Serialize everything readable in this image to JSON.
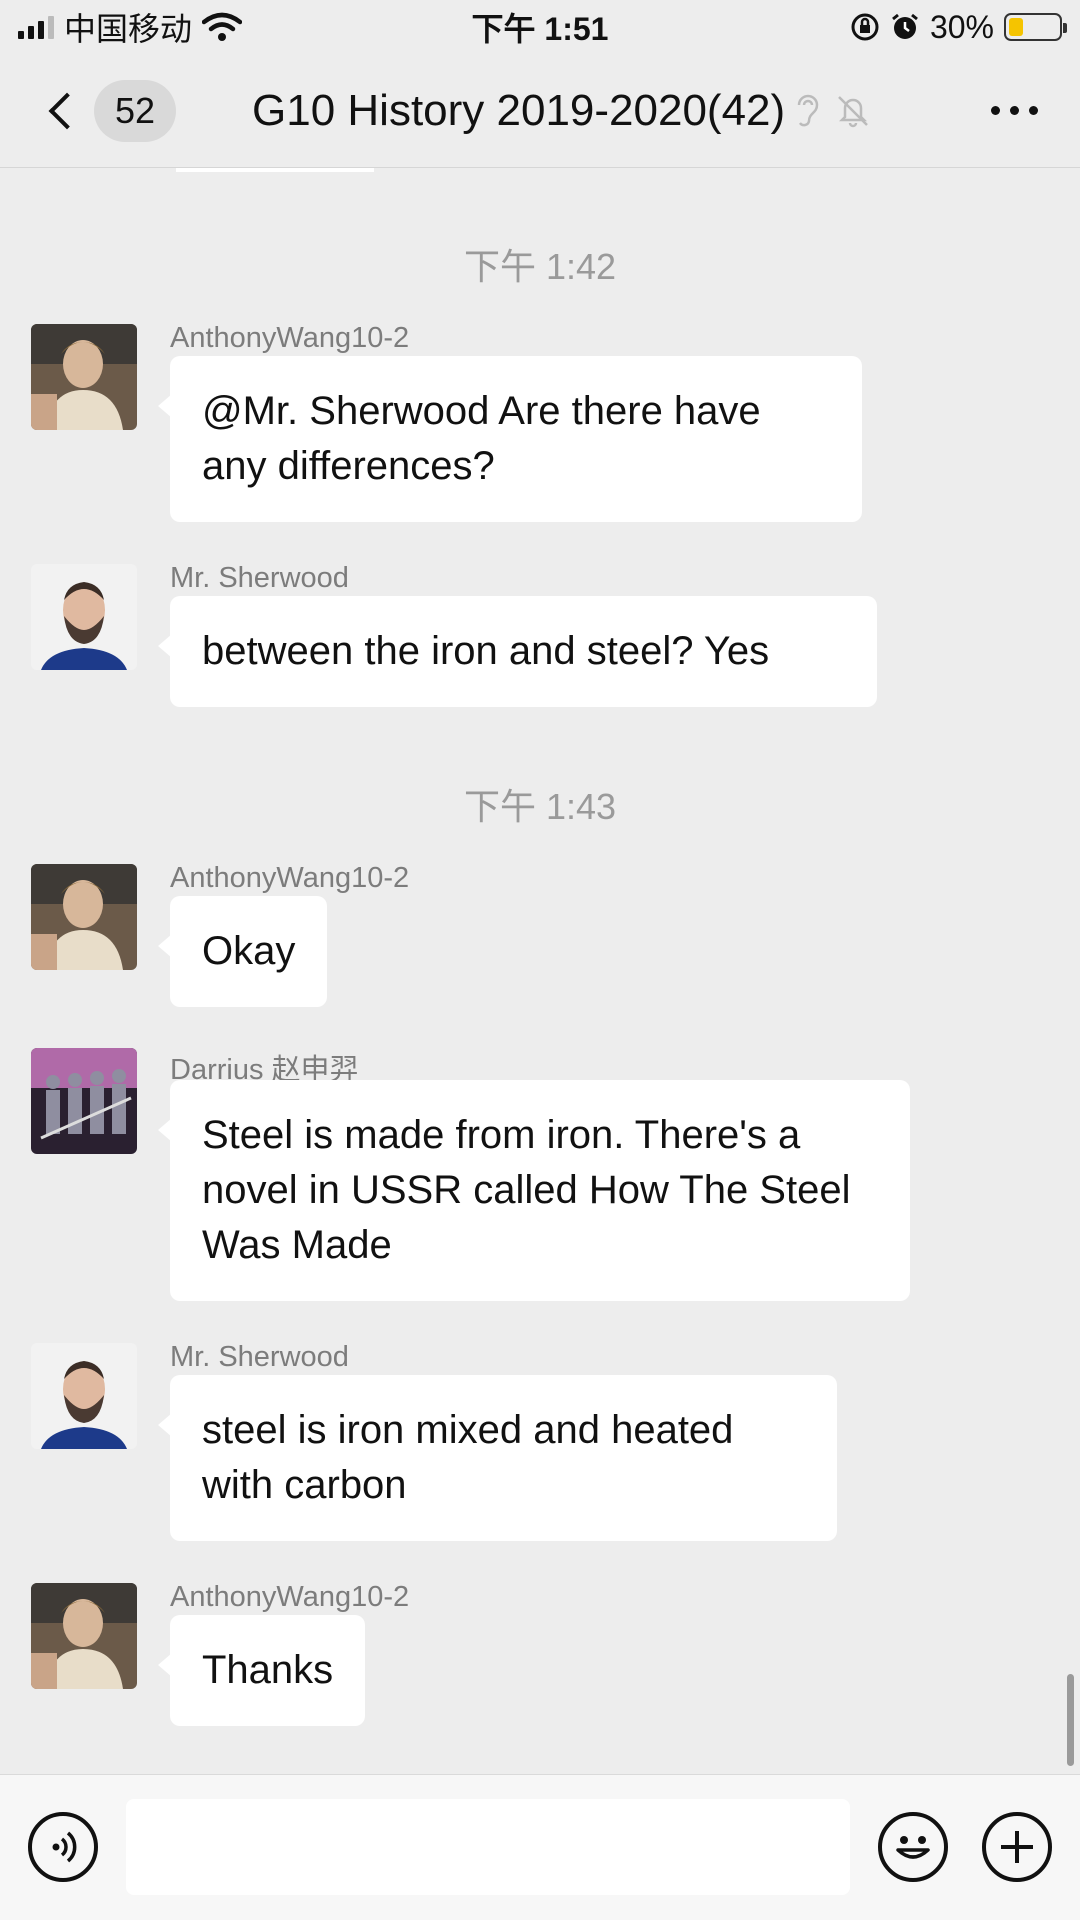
{
  "status_bar": {
    "carrier": "中国移动",
    "time": "下午 1:51",
    "battery_text": "30%",
    "battery_level": 0.3,
    "icons": [
      "signal-icon",
      "wifi-icon",
      "orientation-lock-icon",
      "alarm-icon",
      "battery-icon"
    ]
  },
  "nav": {
    "unread_count": "52",
    "title": "G10 History 2019-2020(42)",
    "icons": [
      "back-chevron-icon",
      "ear-icon",
      "muted-bell-icon",
      "more-icon"
    ]
  },
  "chat": {
    "time_dividers": [
      "下午 1:42",
      "下午 1:43"
    ],
    "messages": [
      {
        "sender": "AnthonyWang10-2",
        "avatar": "avatar-anthony",
        "text": "@Mr. Sherwood Are there have any differences?"
      },
      {
        "sender": "Mr. Sherwood",
        "avatar": "avatar-sherwood",
        "text": "between the iron and steel?  Yes"
      },
      {
        "sender": "AnthonyWang10-2",
        "avatar": "avatar-anthony",
        "text": "Okay"
      },
      {
        "sender": "Darrius 赵申羿",
        "avatar": "avatar-darrius",
        "text": "Steel is made from iron. There's a novel in USSR called How The Steel Was Made"
      },
      {
        "sender": "Mr. Sherwood",
        "avatar": "avatar-sherwood",
        "text": "steel is iron mixed and heated with carbon"
      },
      {
        "sender": "AnthonyWang10-2",
        "avatar": "avatar-anthony",
        "text": "Thanks"
      }
    ]
  },
  "input_bar": {
    "input_value": "",
    "icons": [
      "voice-icon",
      "emoji-icon",
      "plus-icon"
    ]
  },
  "colors": {
    "background": "#ededed",
    "bubble": "#ffffff",
    "battery_fill": "#f5c400",
    "timestamp": "#9a9a9a"
  }
}
